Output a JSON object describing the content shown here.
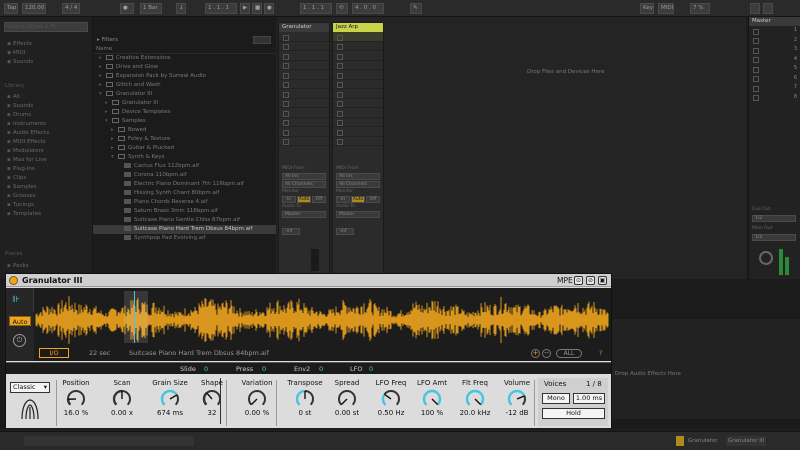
{
  "topbar": {
    "tap": "Tap",
    "tempo": "120.00",
    "time_sig": "4 / 4",
    "metronome": "1 Bar",
    "position": "1 . 1 . 1",
    "loop_start": "1 . 1 . 1",
    "loop_len": "4 . 0 . 0",
    "key": "Key",
    "midi": "MIDI",
    "cpu": "7 %"
  },
  "sidebar": {
    "collections_items": [
      "Effects",
      "MIDI",
      "Sounds"
    ],
    "categories_head": "Library",
    "categories": [
      "All",
      "Sounds",
      "Drums",
      "Instruments",
      "Audio Effects",
      "MIDI Effects",
      "Modulators",
      "Max for Live",
      "Plug-Ins",
      "Clips",
      "Samples",
      "Grooves",
      "Tunings",
      "Templates"
    ],
    "places_head": "Places",
    "places": [
      "Packs"
    ]
  },
  "browser": {
    "search_placeholder": "Search (Cmd + F)",
    "filters_label": "Filters",
    "name_header": "Name",
    "rows": [
      "Creative Extensions",
      "Drive and Glow",
      "Expansion Pack by Surreal Audio",
      "Glitch and Wash",
      "Granulator III",
      "Granulator III",
      "Device Templates",
      "Samples",
      "Bowed",
      "Foley & Texture",
      "Guitar & Plucked",
      "Synth & Keys",
      "Cactus Flux 112bpm.aif",
      "Corona 110bpm.aif",
      "Electric Piano Dominant 7th 116bpm.aif",
      "Hissing Synth Chant 80bpm.aif",
      "Piano Chords Reverse 4.aif",
      "Saturn Brass 3min 116bpm.aif",
      "Suitcase Piano Gentle Chlss 87bpm.aif",
      "Suitcase Piano Hard Trem Dbsus 84bpm.aif",
      "Synthpop Pad Evolving.aif"
    ]
  },
  "session": {
    "drop_hint": "Drop Files and Devices Here",
    "tracks": [
      {
        "name": "Granulator",
        "color": "#4a4a4a"
      },
      {
        "name": "Jazz Arp",
        "color": "#c8d34a"
      }
    ],
    "midi_from": "MIDI From",
    "all_ins": "All Ins",
    "all_channels": "All Channels",
    "monitor": "Monitor",
    "monitor_opts": [
      "In",
      "Auto",
      "Off"
    ],
    "audio_to": "Audio To",
    "master_label": "Master",
    "volume_val": "-inf",
    "master_tracks": [
      "1",
      "2",
      "3",
      "4",
      "5",
      "6",
      "7",
      "8"
    ],
    "cue_out": "Cue Out",
    "cue_out_val": "1/2",
    "main_out": "Main Out",
    "main_out_val": "1/2"
  },
  "lower": {
    "drop_hint": "Drop Audio Effects Here"
  },
  "status": {
    "track_label": "Granulator",
    "clip_label": "Granulator III"
  },
  "device": {
    "title": "Granulator III",
    "mpe": "MPE",
    "auto": "Auto",
    "io": "I/O",
    "duration": "22 sec",
    "sample_name": "Suitcase Piano Hard Trem Dbsus 84bpm.aif",
    "all": "ALL",
    "help": "?",
    "mode": "Classic",
    "mod": [
      {
        "label": "Slide",
        "value": "0"
      },
      {
        "label": "Press",
        "value": "0"
      },
      {
        "label": "Env2",
        "value": "0"
      },
      {
        "label": "LFO",
        "value": "0"
      }
    ],
    "knobs": [
      {
        "label": "Position",
        "value": "16.0 %",
        "fill": 0.16,
        "cyan": false
      },
      {
        "label": "Scan",
        "value": "0.00 x",
        "fill": 0.5,
        "cyan": false
      },
      {
        "label": "Grain Size",
        "value": "674 ms",
        "fill": 0.72,
        "cyan": true
      },
      {
        "label": "Shape",
        "value": "32",
        "fill": 0.35,
        "cyan": false
      },
      {
        "label": "Variation",
        "value": "0.00 %",
        "fill": 0.0,
        "cyan": false
      },
      {
        "label": "Transpose",
        "value": "0 st",
        "fill": 0.5,
        "cyan": true
      },
      {
        "label": "Spread",
        "value": "0.00 st",
        "fill": 0.0,
        "cyan": false
      },
      {
        "label": "LFO Freq",
        "value": "0.50 Hz",
        "fill": 0.3,
        "cyan": true
      },
      {
        "label": "LFO Amt",
        "value": "100 %",
        "fill": 1.0,
        "cyan": true
      },
      {
        "label": "Flt Freq",
        "value": "20.0 kHz",
        "fill": 1.0,
        "cyan": true
      },
      {
        "label": "Volume",
        "value": "-12 dB",
        "fill": 0.75,
        "cyan": true
      }
    ],
    "voices_label": "Voices",
    "voices_value": "1 / 8",
    "mono": "Mono",
    "glide": "1.00 ms",
    "hold": "Hold",
    "colors": {
      "accent": "#f0a51d",
      "cyan": "#46c6e6"
    }
  }
}
